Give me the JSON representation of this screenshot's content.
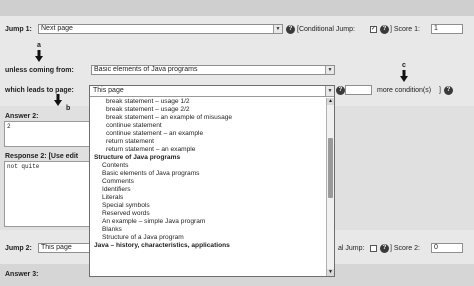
{
  "jump1": {
    "label": "Jump 1:",
    "page_value": "Next page",
    "help": "?",
    "conditional_label": "[Conditional Jump:",
    "conditional_checked": true,
    "score_sep": "] Score 1:",
    "score_value": "1"
  },
  "callouts": {
    "a": "a",
    "b": "b",
    "c": "c"
  },
  "unless": {
    "label": "unless coming from:",
    "value": "Basic elements of Java programs"
  },
  "leads": {
    "label": "which leads to page:",
    "value": "This page",
    "more_label": "more condition(s)",
    "help": "?",
    "bracket_open": "[",
    "bracket_close": "]"
  },
  "answer2": {
    "label": "Answer 2:",
    "value": "2"
  },
  "response2": {
    "label": "Response 2: [Use edit",
    "value": "not quite"
  },
  "jump2": {
    "label": "Jump 2:",
    "page_value": "This page",
    "conditional_label": "al Jump:",
    "conditional_checked": false,
    "help": "?",
    "score_sep": "] Score 2:",
    "score_value": "0"
  },
  "answer3": {
    "label": "Answer 3:"
  },
  "dropdown": {
    "selected": "This page",
    "options": [
      {
        "text": "break statement – usage 1/2",
        "level": 2
      },
      {
        "text": "break statement – usage 2/2",
        "level": 2
      },
      {
        "text": "break statement – an example of misusage",
        "level": 2
      },
      {
        "text": "continue statement",
        "level": 2
      },
      {
        "text": "continue statement – an example",
        "level": 2
      },
      {
        "text": "return statement",
        "level": 2
      },
      {
        "text": "return statement – an example",
        "level": 2
      },
      {
        "text": "Structure of Java programs",
        "level": 0
      },
      {
        "text": "Contents",
        "level": 1
      },
      {
        "text": "Basic elements of Java programs",
        "level": 1
      },
      {
        "text": "Comments",
        "level": 1
      },
      {
        "text": "Identifiers",
        "level": 1
      },
      {
        "text": "Literals",
        "level": 1
      },
      {
        "text": "Special symbols",
        "level": 1
      },
      {
        "text": "Reserved words",
        "level": 1
      },
      {
        "text": "An example – simple Java program",
        "level": 1
      },
      {
        "text": "Blanks",
        "level": 1
      },
      {
        "text": "Structure of a Java program",
        "level": 1
      },
      {
        "text": "Java – history, characteristics, applications",
        "level": 0
      }
    ]
  },
  "icons": {
    "help": "question-circle-icon",
    "select": "chevron-down-icon",
    "arrow": "down-arrow-icon"
  },
  "colors": {
    "band": "#e6e6e6",
    "band_dark": "#d2d2d2",
    "field_border": "#8f8f8f",
    "help_bg": "#3a3a3a"
  }
}
